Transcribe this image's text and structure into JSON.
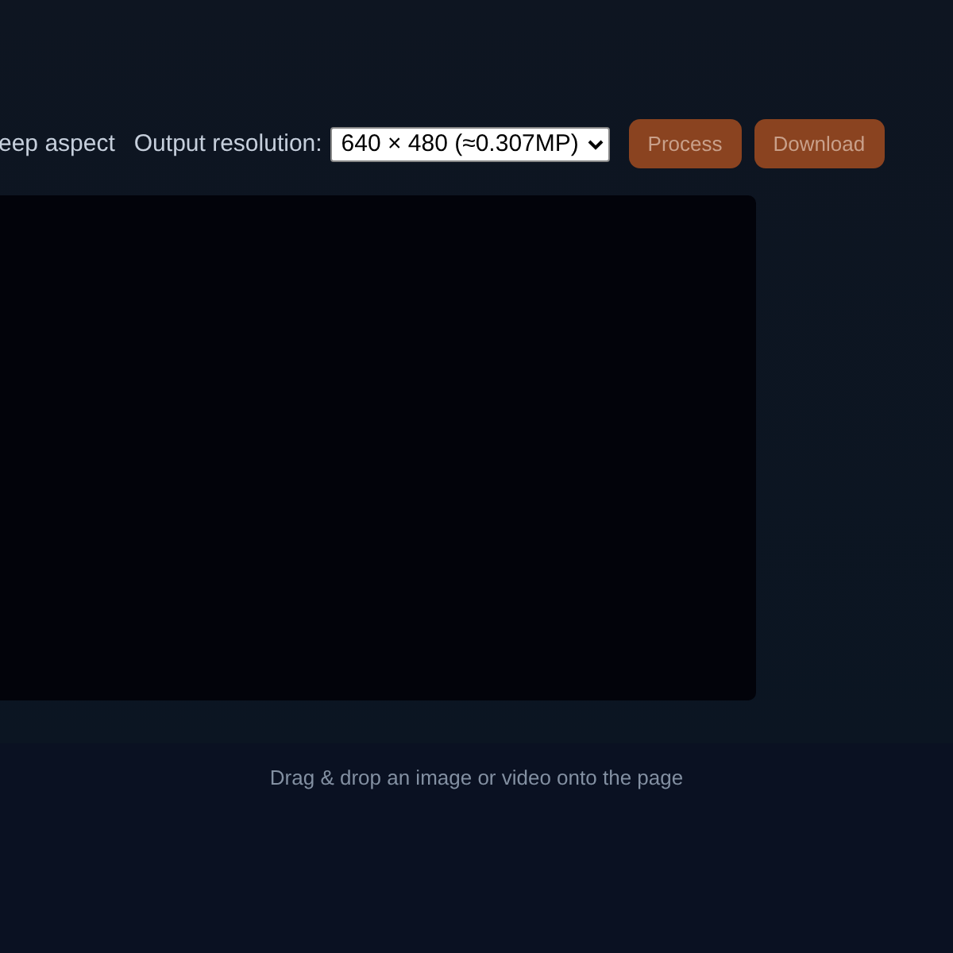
{
  "toolbar": {
    "keep_aspect_label": "eep aspect",
    "resolution_label": "Output resolution:",
    "resolution_value": "640 × 480 (≈0.307MP)",
    "buttons": [
      {
        "label": "Process",
        "disabled": true
      },
      {
        "label": "Download",
        "disabled": true
      }
    ]
  },
  "footer": {
    "hint": "Drag & drop an image or video onto the page"
  }
}
